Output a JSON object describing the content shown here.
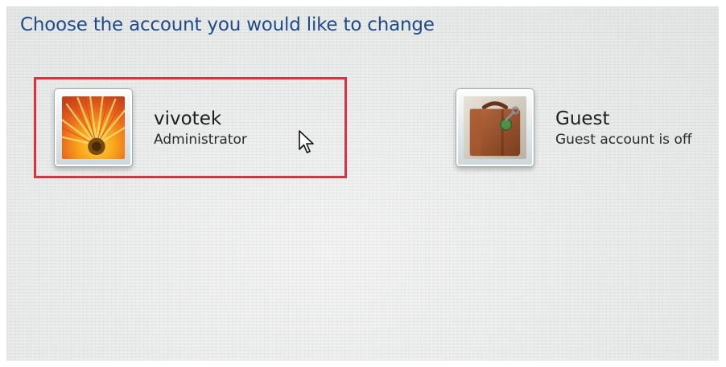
{
  "heading": "Choose the account you would like to change",
  "accounts": [
    {
      "name": "vivotek",
      "role": "Administrator",
      "picture_icon": "flower-icon",
      "selected": true
    },
    {
      "name": "Guest",
      "role": "Guest account is off",
      "picture_icon": "suitcase-icon",
      "selected": false
    }
  ],
  "colors": {
    "heading": "#1f4a8c",
    "selection_border": "#e0303d"
  }
}
